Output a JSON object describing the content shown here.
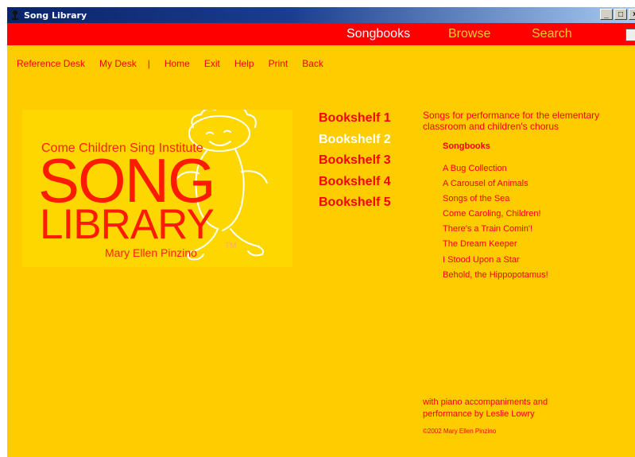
{
  "window": {
    "title": "Song Library",
    "controls": [
      "_",
      "□",
      "×"
    ]
  },
  "topnav": {
    "songbooks": "Songbooks",
    "browse": "Browse",
    "search": "Search"
  },
  "subnav": {
    "reference_desk": "Reference Desk",
    "my_desk": "My Desk",
    "separator": "|",
    "home": "Home",
    "exit": "Exit",
    "help": "Help",
    "print": "Print",
    "back": "Back"
  },
  "logo": {
    "institute": "Come Children Sing Institute",
    "song": "SONG",
    "library": "LIBRARY",
    "tm": "TM",
    "author": "Mary Ellen Pinzino"
  },
  "bookshelves": [
    {
      "label": "Bookshelf 1",
      "active": false
    },
    {
      "label": "Bookshelf 2",
      "active": true
    },
    {
      "label": "Bookshelf 3",
      "active": false
    },
    {
      "label": "Bookshelf 4",
      "active": false
    },
    {
      "label": "Bookshelf 5",
      "active": false
    }
  ],
  "info": {
    "description": "Songs for performance for the elementary classroom and children's chorus",
    "heading": "Songbooks",
    "songs": [
      "A Bug Collection",
      "A Carousel of Animals",
      "Songs of the Sea",
      "Come Caroling, Children!",
      "There's a Train Comin'!",
      "The Dream Keeper",
      "I Stood Upon a Star",
      "Behold, the Hippopotamus!"
    ]
  },
  "footer": {
    "accompaniment": "with piano accompaniments and performance by Leslie Lowry",
    "copyright": "©2002 Mary Ellen Pinzino"
  },
  "colors": {
    "background": "#ffcc00",
    "nav_bar": "#ff0000",
    "text": "#ff0000",
    "active": "#ffffff"
  }
}
